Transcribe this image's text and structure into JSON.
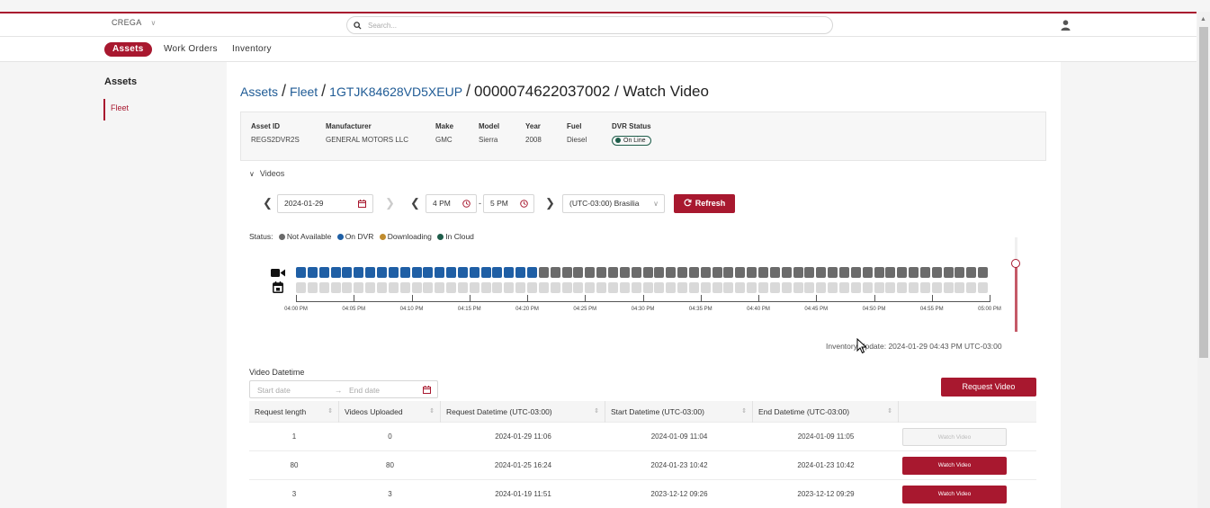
{
  "colors": {
    "brand": "#a8182f",
    "link": "#1f5b95",
    "status_not_available": "#6b6b6b",
    "status_on_dvr": "#1f5fa5",
    "status_downloading": "#c08c2e",
    "status_in_cloud": "#1e5d4a",
    "slot_empty": "#d9d9d9"
  },
  "topbar": {
    "company": "CREGA",
    "search_placeholder": "Search..."
  },
  "nav": {
    "items": [
      {
        "label": "Assets"
      },
      {
        "label": "Work Orders"
      },
      {
        "label": "Inventory"
      }
    ]
  },
  "sidebar": {
    "title": "Assets",
    "items": [
      {
        "label": "Fleet"
      }
    ]
  },
  "breadcrumb": {
    "assets": "Assets",
    "fleet": "Fleet",
    "vin": "1GTJK84628VD5XEUP",
    "current": "0000074622037002 / Watch Video",
    "separator": "/"
  },
  "asset": {
    "fields": [
      {
        "label": "Asset ID",
        "value": "REGS2DVR2S"
      },
      {
        "label": "Manufacturer",
        "value": "GENERAL MOTORS LLC"
      },
      {
        "label": "Make",
        "value": "GMC"
      },
      {
        "label": "Model",
        "value": "Sierra"
      },
      {
        "label": "Year",
        "value": "2008"
      },
      {
        "label": "Fuel",
        "value": "Diesel"
      }
    ],
    "dvr_status_label": "DVR Status",
    "dvr_status_value": "On Line"
  },
  "videos": {
    "section_label": "Videos",
    "date": "2024-01-29",
    "start_time": "4 PM",
    "end_time": "5 PM",
    "time_dash": "-",
    "timezone": "(UTC-03:00) Brasilia",
    "refresh_label": "Refresh"
  },
  "status_legend": {
    "label": "Status:",
    "items": [
      "Not Available",
      "On DVR",
      "Downloading",
      "In Cloud"
    ]
  },
  "timeline": {
    "slots_total": 60,
    "slots_on_dvr": 21,
    "tick_labels": [
      "04:00 PM",
      "04:05 PM",
      "04:10 PM",
      "04:15 PM",
      "04:20 PM",
      "04:25 PM",
      "04:30 PM",
      "04:35 PM",
      "04:40 PM",
      "04:45 PM",
      "04:50 PM",
      "04:55 PM",
      "05:00 PM"
    ],
    "zoom_level": 0.7
  },
  "inventory_update": "Inventory Update: 2024-01-29 04:43 PM UTC-03:00",
  "request": {
    "datetime_label": "Video Datetime",
    "start_placeholder": "Start date",
    "range_arrow": "→",
    "end_placeholder": "End date",
    "button": "Request Video"
  },
  "table": {
    "headers": [
      "Request length",
      "Videos Uploaded",
      "Request Datetime (UTC-03:00)",
      "Start Datetime (UTC-03:00)",
      "End Datetime (UTC-03:00)",
      ""
    ],
    "rows": [
      {
        "length": "1",
        "uploaded": "0",
        "requested": "2024-01-29 11:06",
        "start": "2024-01-09 11:04",
        "end": "2024-01-09 11:05",
        "action": "Watch Video",
        "enabled": false
      },
      {
        "length": "80",
        "uploaded": "80",
        "requested": "2024-01-25 16:24",
        "start": "2024-01-23 10:42",
        "end": "2024-01-23 10:42",
        "action": "Watch Video",
        "enabled": true
      },
      {
        "length": "3",
        "uploaded": "3",
        "requested": "2024-01-19 11:51",
        "start": "2023-12-12 09:26",
        "end": "2023-12-12 09:29",
        "action": "Watch Video",
        "enabled": true
      }
    ]
  }
}
